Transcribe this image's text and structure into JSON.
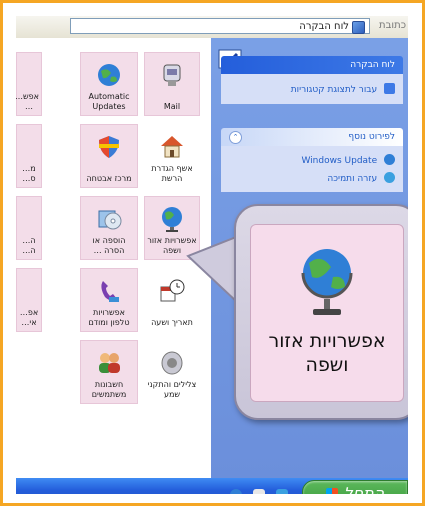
{
  "window": {
    "address_label": "כתובת",
    "address_value": "לוח הבקרה"
  },
  "icons": [
    {
      "id": "mail",
      "label": "Mail"
    },
    {
      "id": "automatic-updates",
      "label": "Automatic Updates"
    },
    {
      "id": "cut-left-1",
      "label": "אפש… …"
    },
    {
      "id": "home-network",
      "label": "אשף הגדרת הרשת"
    },
    {
      "id": "security-center",
      "label": "מרכז אבטחה"
    },
    {
      "id": "cut-left-2",
      "label": "מ… ס…"
    },
    {
      "id": "regional-options",
      "label": "אפשרויות אזור ושפה"
    },
    {
      "id": "add-remove",
      "label": "הוספה או הסרה …"
    },
    {
      "id": "cut-left-3",
      "label": "ה… ה…"
    },
    {
      "id": "date-time",
      "label": "תאריך ושעה"
    },
    {
      "id": "phone-modem",
      "label": "אפשרויות טלפון ומודם"
    },
    {
      "id": "cut-left-4",
      "label": "אפ… אי…"
    },
    {
      "id": "sounds-audio",
      "label": "צלילים והתקני שמע"
    },
    {
      "id": "user-accounts",
      "label": "חשבונות משתמשים"
    }
  ],
  "task_pane": {
    "control_panel_header": "לוח הבקרה",
    "switch_view_link": "עבור לתצוגת קטגוריות",
    "see_also_header": "לפירוט נוסף",
    "windows_update_link": "Windows Update",
    "help_link": "עזרה ותמיכה"
  },
  "callout": {
    "label": "אפשרויות אזור ושפה"
  },
  "taskbar": {
    "start_label": "התחל"
  }
}
